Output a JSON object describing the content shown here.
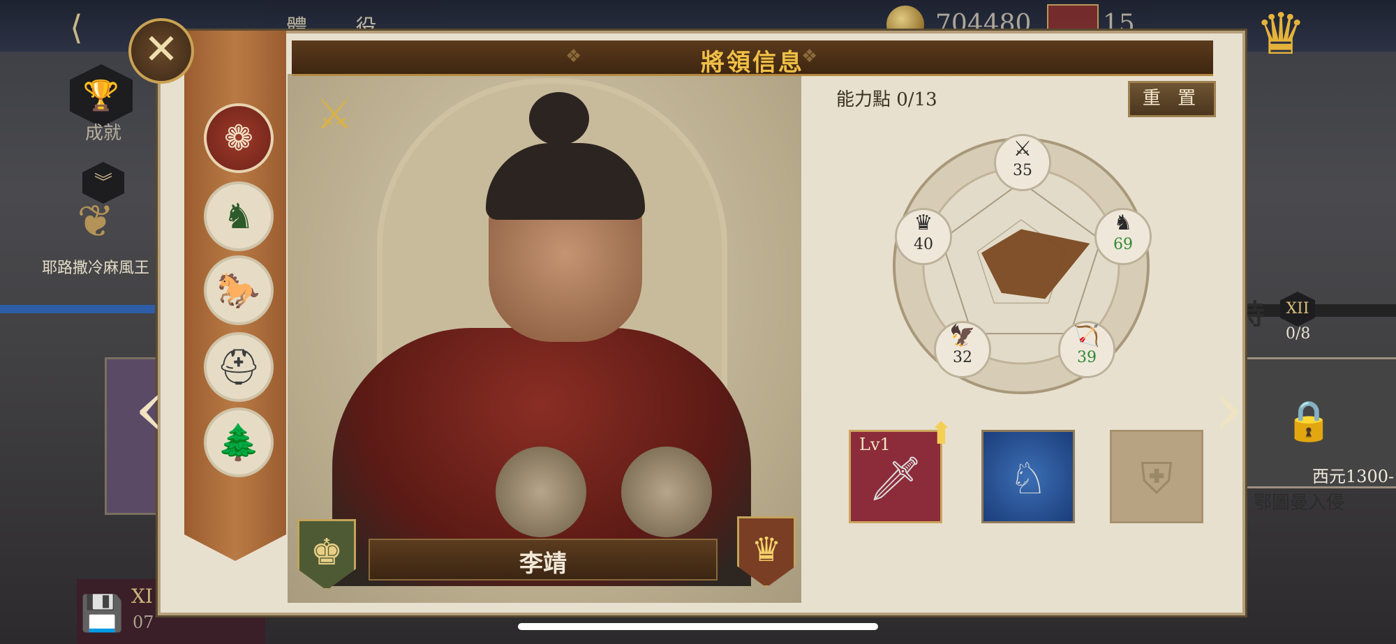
{
  "modal": {
    "title": "將領信息",
    "close_icon": "close-icon"
  },
  "general": {
    "name": "李靖",
    "class_icon": "crossed-swords-shield-icon",
    "left_badge_icon": "chess-king-icon",
    "right_badge_icon": "crown-icon"
  },
  "traits": [
    {
      "name": "fire-emblem-icon",
      "glyph": "❁"
    },
    {
      "name": "knight-horse-icon",
      "glyph": "♞"
    },
    {
      "name": "galloping-horse-icon",
      "glyph": "🐎"
    },
    {
      "name": "helmet-icon",
      "glyph": "⛑"
    },
    {
      "name": "forest-icon",
      "glyph": "🌲"
    }
  ],
  "ability": {
    "points_label": "能力點 0/13",
    "reset_label": "重 置"
  },
  "stats": {
    "attack": {
      "icon": "crossed-swords-icon",
      "glyph": "⚔",
      "value": "35",
      "boosted": false
    },
    "cavalry": {
      "icon": "knight-icon",
      "glyph": "♞",
      "value": "69",
      "boosted": true
    },
    "archery": {
      "icon": "bow-icon",
      "glyph": "🏹",
      "value": "39",
      "boosted": true
    },
    "infantry": {
      "icon": "eagle-icon",
      "glyph": "🦅",
      "value": "32",
      "boosted": false
    },
    "command": {
      "icon": "crown-icon",
      "glyph": "♛",
      "value": "40",
      "boosted": false
    }
  },
  "equipment": {
    "weapon": {
      "level": "Lv1",
      "icon": "sword-icon",
      "glyph": "🗡"
    },
    "horse": {
      "icon": "armored-horse-icon",
      "glyph": "♘"
    },
    "empty": {
      "icon": "empty-shield-slot-icon",
      "glyph": "⛨"
    }
  },
  "background": {
    "top_crumb": "體 役",
    "coins": "704480",
    "banners": "15",
    "achievement_label": "成就",
    "king_label": "耶路撒冷麻風王",
    "right_wait": "待",
    "right_badge": "XII",
    "right_progress": "0/8",
    "right_year": "西元1300-",
    "right_event": "鄂圖曼入侵",
    "bottom_roman": "XI",
    "bottom_num": "07"
  },
  "colors": {
    "title_gold": "#f0c046",
    "boost_green": "#2f8a36",
    "radar_fill": "#7a4a22",
    "banner_brown": "#b97a44"
  }
}
